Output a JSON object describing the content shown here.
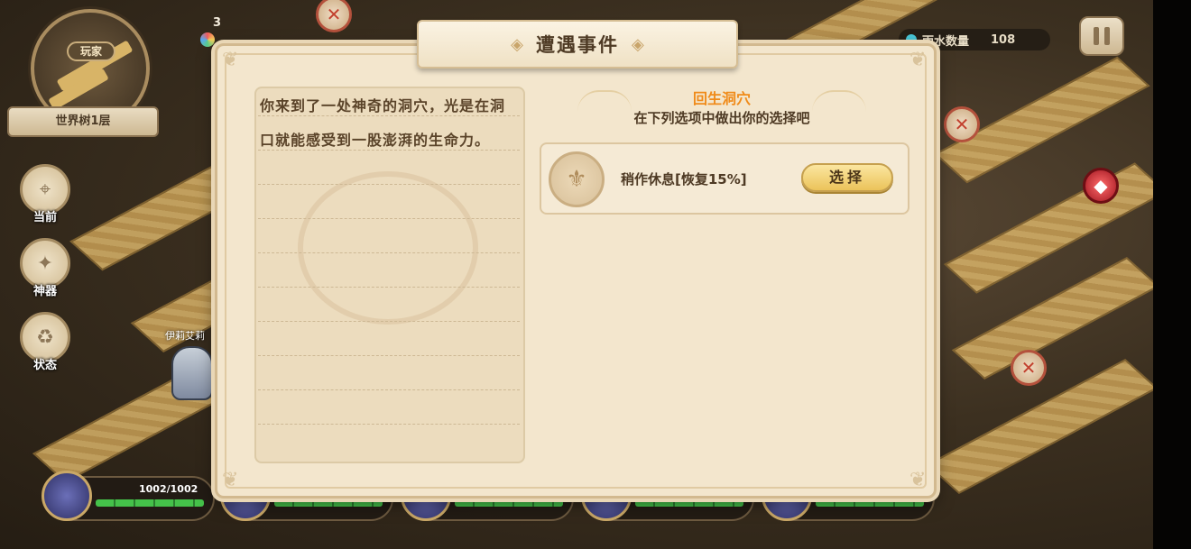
{
  "hud": {
    "minimap_label": "玩家",
    "floor_name": "世界树1层",
    "gem_count": "3",
    "water_label": "雨水数量",
    "water_value": "108",
    "side_buttons": [
      {
        "label": "当前",
        "icon": "location-pin-icon"
      },
      {
        "label": "神器",
        "icon": "star-compass-icon"
      },
      {
        "label": "状态",
        "icon": "recycle-icon"
      }
    ],
    "hero_name_tag": "伊莉艾莉",
    "party_hp": "1002/1002"
  },
  "dialog": {
    "title": "遭遇事件",
    "story": "你来到了一处神奇的洞穴，光是在洞口就能感受到一股澎湃的生命力。",
    "location": "回生洞穴",
    "instruction": "在下列选项中做出你的选择吧",
    "options": [
      {
        "label": "稍作休息[恢复15%]",
        "button": "选择"
      }
    ]
  },
  "colors": {
    "accent_orange": "#f08b1a",
    "panel_bg": "#f3e6cd",
    "button_gold": "#ebc35a",
    "hp_green": "#45c24a"
  }
}
